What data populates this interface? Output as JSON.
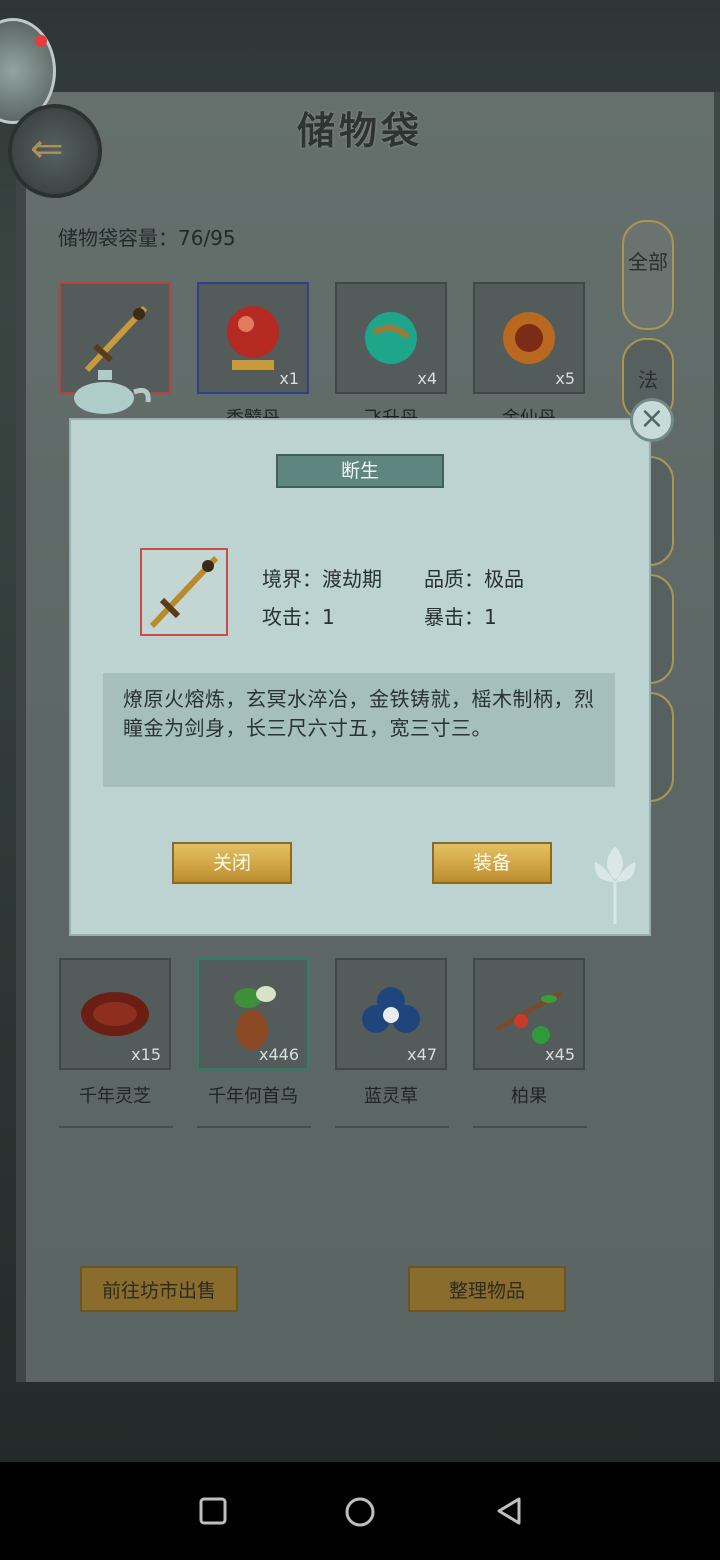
{
  "window": {
    "title": "储物袋"
  },
  "capacity_text": "储物袋容量：76/95",
  "side_tabs": [
    {
      "label": "全部"
    },
    {
      "label": "法"
    }
  ],
  "top_items": [
    {
      "name": "",
      "count": "",
      "icon": "sword-icon"
    },
    {
      "name": "秀髓丹",
      "count": "x1",
      "icon": "red-orb-icon"
    },
    {
      "name": "飞升丹",
      "count": "x4",
      "icon": "green-orb-icon"
    },
    {
      "name": "金仙丹",
      "count": "x5",
      "icon": "amber-pill-icon"
    }
  ],
  "bottom_items": [
    {
      "name": "千年灵芝",
      "count": "x15",
      "icon": "lingzhi-icon"
    },
    {
      "name": "千年何首乌",
      "count": "x446",
      "icon": "heshouwu-icon"
    },
    {
      "name": "蓝灵草",
      "count": "x47",
      "icon": "blue-flower-icon"
    },
    {
      "name": "柏果",
      "count": "x45",
      "icon": "berry-branch-icon"
    }
  ],
  "footer_buttons": {
    "sell": "前往坊市出售",
    "organize": "整理物品"
  },
  "modal": {
    "title": "断生",
    "realm_label": "境界：",
    "realm_value": "渡劫期",
    "quality_label": "品质：",
    "quality_value": "极品",
    "attack_label": "攻击：",
    "attack_value": "1",
    "crit_label": "暴击：",
    "crit_value": "1",
    "description": "燎原火熔炼，玄冥水淬冶，金铁铸就，榣木制柄，烈瞳金为剑身，长三尺六寸五，宽三寸三。",
    "close_label": "关闭",
    "equip_label": "装备",
    "close_icon": "×"
  },
  "colors": {
    "modal_bg": "#bcd3d2",
    "gold_button": "#cfa341",
    "selected_border": "#c84c48"
  }
}
